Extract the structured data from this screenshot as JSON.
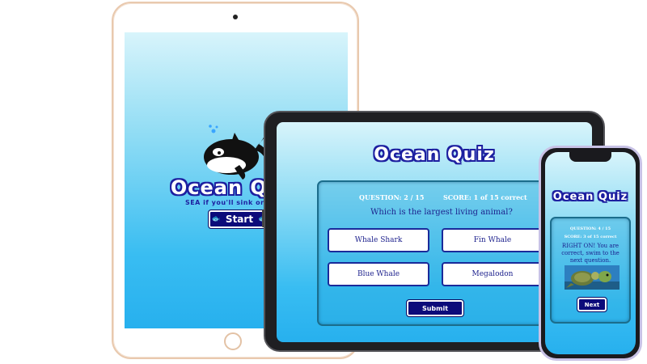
{
  "tablet_large": {
    "title": "Ocean Quiz",
    "tagline": "SEA if you'll sink or swim",
    "start_label": "Start",
    "fish_icon": "🐟"
  },
  "tablet_mid": {
    "title": "Ocean Quiz",
    "question_counter": "QUESTION: 2 / 15",
    "score": "SCORE: 1 of 15 correct",
    "question": "Which is the largest living animal?",
    "answers": [
      "Whale Shark",
      "Fin Whale",
      "Blue Whale",
      "Megalodon"
    ],
    "submit_label": "Submit"
  },
  "phone": {
    "title": "Ocean Quiz",
    "question_counter": "QUESTION: 4 / 15",
    "score": "SCORE: 3 of 15 correct",
    "feedback": "RIGHT ON! You are correct, swim to the next question.",
    "next_label": "Next"
  },
  "colors": {
    "title_outline": "#1d1fa0",
    "button_bg": "#0c0b7a",
    "answer_text": "#1b1f8c"
  }
}
